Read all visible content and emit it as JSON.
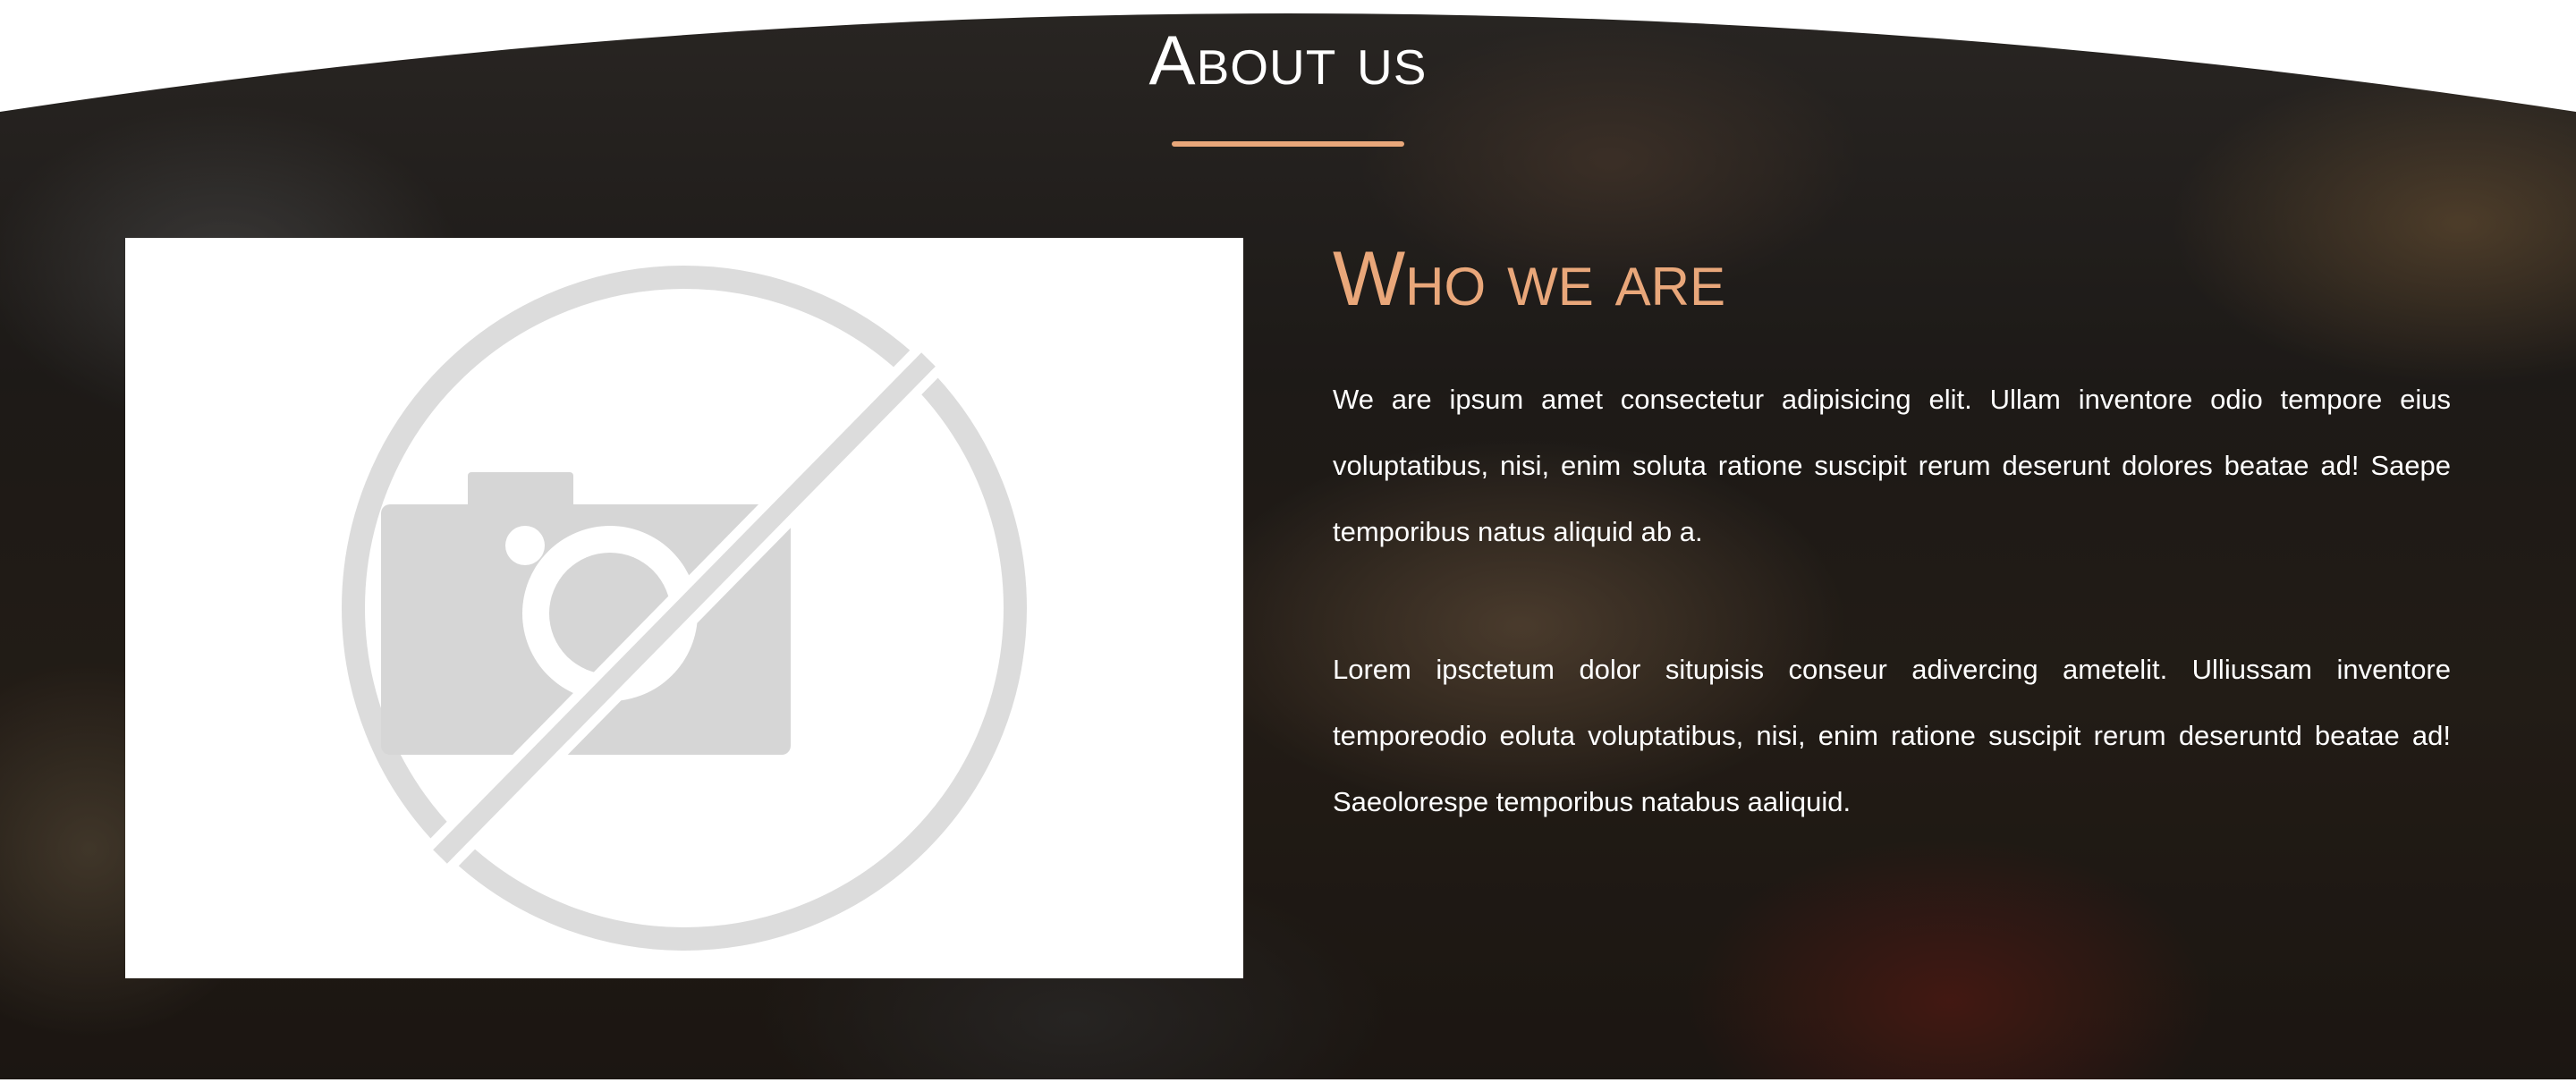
{
  "about": {
    "title": "About us",
    "subtitle": "Who we are",
    "paragraphs": [
      "We are ipsum amet consectetur adipisicing elit. Ullam inventore odio tempore eius voluptatibus, nisi, enim soluta ratione suscipit rerum deserunt dolores beatae ad! Saepe temporibus natus aliquid ab a.",
      "Lorem ipsctetum dolor situpisis conseur adivercing ametelit. Ulliussam inventore temporeodio eoluta voluptatibus, nisi, enim ratione suscipit rerum deseruntd beatae ad! Saeolorespe temporibus natabus aaliquid."
    ]
  },
  "colors": {
    "accent": "#e9a77a",
    "text": "#ffffff",
    "placeholder_icon": "#d9d9d9"
  },
  "icons": {
    "placeholder": "no-image-icon"
  }
}
